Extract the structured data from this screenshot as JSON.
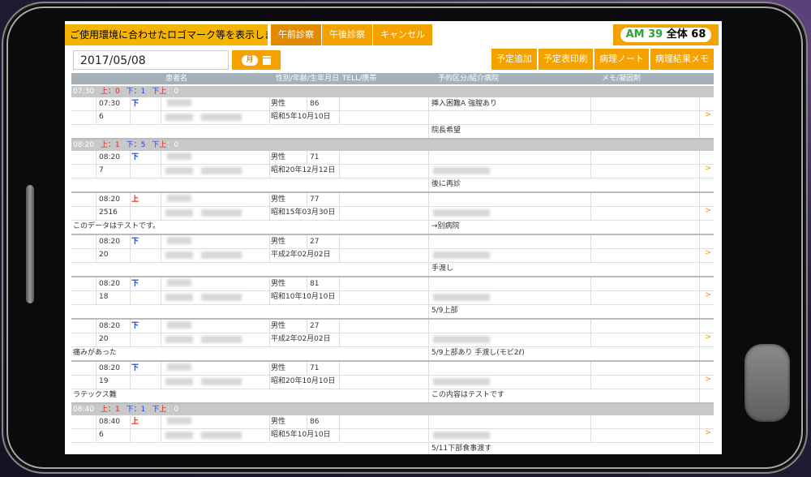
{
  "notice": "ご使用環境に合わせたロゴマーク等を表示します。",
  "tabs": [
    "午前診察",
    "午後診察",
    "キャンセル"
  ],
  "counts": {
    "am_label": "AM",
    "am_value": "39",
    "all_label": "全体",
    "all_value": "68"
  },
  "date": "2017/05/08",
  "month_button": "月",
  "actions": [
    "予定追加",
    "予定表印刷",
    "病理ノート",
    "病理結果メモ"
  ],
  "headers": {
    "name": "患者名",
    "info": "性別/年齢/生年月日",
    "tel": "TELL/携帯",
    "type": "予約区分/紹介病院",
    "memo": "メモ/凝固剤"
  },
  "arrow": ">",
  "slots": [
    {
      "time": "07:30",
      "up": "上：0",
      "down": "下：1",
      "both_down": "下",
      "both_up": "上",
      "both": "：0",
      "entries": [
        {
          "time": "07:30",
          "side": "下",
          "side_type": "down",
          "id": "6",
          "sex": "男性",
          "age": "86",
          "birth": "昭和5年10月10日",
          "type": "挿入困難A 強膣あり",
          "note": "",
          "memo": "院長希望"
        }
      ]
    },
    {
      "time": "08:20",
      "up": "上：1",
      "down": "下：5",
      "both_down": "下",
      "both_up": "上",
      "both": "：0",
      "entries": [
        {
          "time": "08:20",
          "side": "下",
          "side_type": "down",
          "id": "7",
          "sex": "男性",
          "age": "71",
          "birth": "昭和20年12月12日",
          "type": "",
          "note": "",
          "memo": "後に再診"
        },
        {
          "time": "08:20",
          "side": "上",
          "side_type": "up",
          "id": "2516",
          "sex": "男性",
          "age": "77",
          "birth": "昭和15年03月30日",
          "type": "",
          "note": "このデータはテストです。",
          "memo": "→別病院"
        },
        {
          "time": "08:20",
          "side": "下",
          "side_type": "down",
          "id": "20",
          "sex": "男性",
          "age": "27",
          "birth": "平成2年02月02日",
          "type": "",
          "note": "",
          "memo": "手渡し"
        },
        {
          "time": "08:20",
          "side": "下",
          "side_type": "down",
          "id": "18",
          "sex": "男性",
          "age": "81",
          "birth": "昭和10年10月10日",
          "type": "",
          "note": "",
          "memo": "5/9上部"
        },
        {
          "time": "08:20",
          "side": "下",
          "side_type": "down",
          "id": "20",
          "sex": "男性",
          "age": "27",
          "birth": "平成2年02月02日",
          "type": "",
          "note": "痛みがあった",
          "memo": "5/9上部あり 手渡し(モビ2ℓ)"
        },
        {
          "time": "08:20",
          "side": "下",
          "side_type": "down",
          "id": "19",
          "sex": "男性",
          "age": "71",
          "birth": "昭和20年10月10日",
          "type": "",
          "note": "ラテックス難",
          "memo": "この内容はテストです"
        }
      ]
    },
    {
      "time": "08:40",
      "up": "上：1",
      "down": "下：1",
      "both_down": "下",
      "both_up": "上",
      "both": "：0",
      "entries": [
        {
          "time": "08:40",
          "side": "上",
          "side_type": "up",
          "id": "6",
          "sex": "男性",
          "age": "86",
          "birth": "昭和5年10月10日",
          "type": "",
          "note": "",
          "memo": "5/11下部食事渡す"
        }
      ]
    }
  ]
}
